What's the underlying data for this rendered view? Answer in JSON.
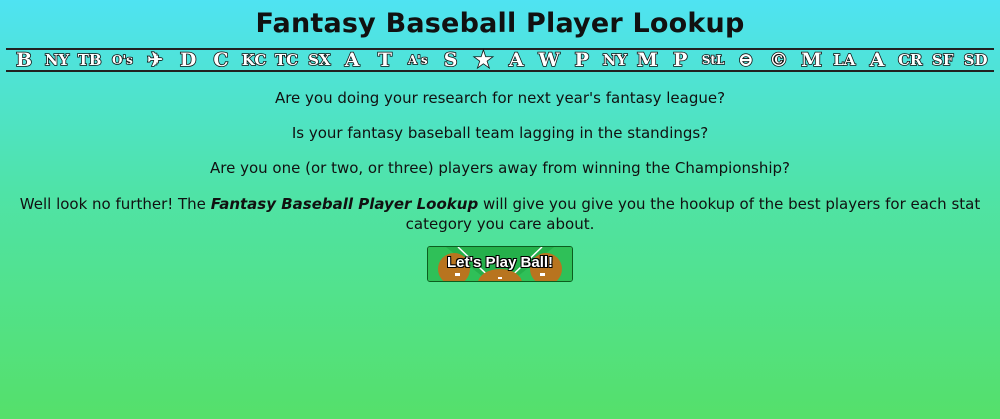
{
  "title": "Fantasy Baseball Player Lookup",
  "team_logos": [
    {
      "glyph": "B",
      "name": "red-sox-logo-icon"
    },
    {
      "glyph": "NY",
      "name": "yankees-logo-icon"
    },
    {
      "glyph": "TB",
      "name": "rays-logo-icon"
    },
    {
      "glyph": "O's",
      "name": "orioles-logo-icon"
    },
    {
      "glyph": "✈",
      "name": "blue-jays-logo-icon"
    },
    {
      "glyph": "D",
      "name": "tigers-logo-icon"
    },
    {
      "glyph": "C",
      "name": "indians-logo-icon"
    },
    {
      "glyph": "KC",
      "name": "royals-logo-icon"
    },
    {
      "glyph": "TC",
      "name": "twins-logo-icon"
    },
    {
      "glyph": "SX",
      "name": "white-sox-logo-icon"
    },
    {
      "glyph": "A",
      "name": "angels-logo-icon"
    },
    {
      "glyph": "T",
      "name": "rangers-logo-icon"
    },
    {
      "glyph": "A's",
      "name": "athletics-logo-icon"
    },
    {
      "glyph": "S",
      "name": "mariners-logo-icon"
    },
    {
      "glyph": "★",
      "name": "astros-logo-icon"
    },
    {
      "glyph": "A",
      "name": "braves-logo-icon"
    },
    {
      "glyph": "W",
      "name": "nationals-logo-icon"
    },
    {
      "glyph": "P",
      "name": "phillies-logo-icon"
    },
    {
      "glyph": "NY",
      "name": "mets-logo-icon"
    },
    {
      "glyph": "M",
      "name": "marlins-logo-icon"
    },
    {
      "glyph": "P",
      "name": "pirates-logo-icon"
    },
    {
      "glyph": "StL",
      "name": "cardinals-logo-icon"
    },
    {
      "glyph": "⊖",
      "name": "reds-logo-icon"
    },
    {
      "glyph": "©",
      "name": "cubs-logo-icon"
    },
    {
      "glyph": "M",
      "name": "brewers-logo-icon"
    },
    {
      "glyph": "LA",
      "name": "dodgers-logo-icon"
    },
    {
      "glyph": "A",
      "name": "diamondbacks-logo-icon"
    },
    {
      "glyph": "CR",
      "name": "rockies-logo-icon"
    },
    {
      "glyph": "SF",
      "name": "giants-logo-icon"
    },
    {
      "glyph": "SD",
      "name": "padres-logo-icon"
    }
  ],
  "intro": {
    "q1": "Are you doing your research for next year's fantasy league?",
    "q2": "Is your fantasy baseball team lagging in the standings?",
    "q3": "Are you one (or two, or three) players away from winning the Championship?",
    "lead_before": "Well look no further! The ",
    "lead_emphasis": "Fantasy Baseball Player Lookup",
    "lead_after": " will give you give you the hookup of the best players for each stat category you care about."
  },
  "play_button": {
    "label": "Let's Play Ball!"
  },
  "colors": {
    "field_green": "#25b04b",
    "infield_dirt": "#b8741f",
    "gradient_top": "#4fe3f2",
    "gradient_bottom": "#55e06a"
  }
}
